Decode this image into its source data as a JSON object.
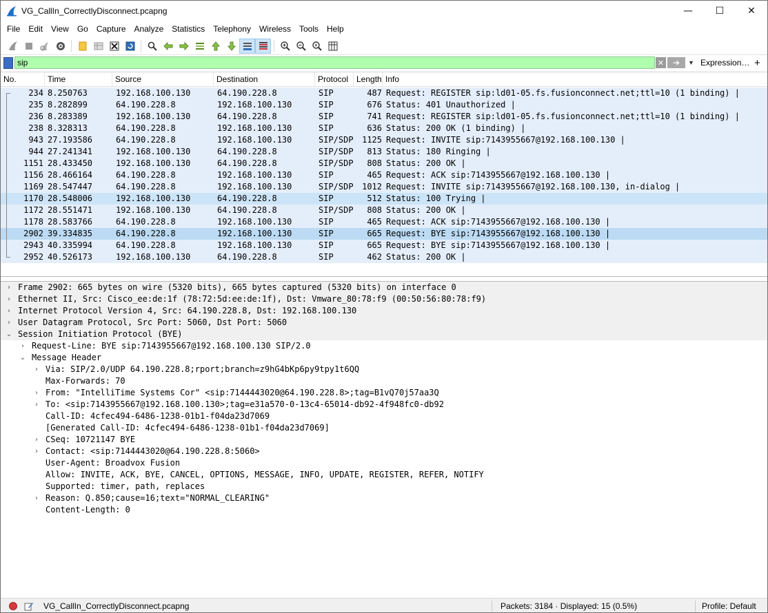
{
  "window": {
    "title": "VG_CallIn_CorrectlyDisconnect.pcapng",
    "minimize_glyph": "—",
    "maximize_glyph": "☐",
    "close_glyph": "✕"
  },
  "menu": [
    "File",
    "Edit",
    "View",
    "Go",
    "Capture",
    "Analyze",
    "Statistics",
    "Telephony",
    "Wireless",
    "Tools",
    "Help"
  ],
  "filter": {
    "value": "sip",
    "expression_label": "Expression…",
    "add_label": "+"
  },
  "packet_list": {
    "columns": [
      "No.",
      "Time",
      "Source",
      "Destination",
      "Protocol",
      "Length",
      "Info"
    ],
    "rows": [
      {
        "no": "234",
        "time": "8.250763",
        "src": "192.168.100.130",
        "dst": "64.190.228.8",
        "proto": "SIP",
        "len": "487",
        "info": "Request: REGISTER sip:ld01-05.fs.fusionconnect.net;ttl=10  (1 binding) |"
      },
      {
        "no": "235",
        "time": "8.282899",
        "src": "64.190.228.8",
        "dst": "192.168.100.130",
        "proto": "SIP",
        "len": "676",
        "info": "Status: 401 Unauthorized |"
      },
      {
        "no": "236",
        "time": "8.283389",
        "src": "192.168.100.130",
        "dst": "64.190.228.8",
        "proto": "SIP",
        "len": "741",
        "info": "Request: REGISTER sip:ld01-05.fs.fusionconnect.net;ttl=10  (1 binding) |"
      },
      {
        "no": "238",
        "time": "8.328313",
        "src": "64.190.228.8",
        "dst": "192.168.100.130",
        "proto": "SIP",
        "len": "636",
        "info": "Status: 200 OK  (1 binding) |"
      },
      {
        "no": "943",
        "time": "27.193586",
        "src": "64.190.228.8",
        "dst": "192.168.100.130",
        "proto": "SIP/SDP",
        "len": "1125",
        "info": "Request: INVITE sip:7143955667@192.168.100.130 |"
      },
      {
        "no": "944",
        "time": "27.241341",
        "src": "192.168.100.130",
        "dst": "64.190.228.8",
        "proto": "SIP/SDP",
        "len": "813",
        "info": "Status: 180 Ringing |"
      },
      {
        "no": "1151",
        "time": "28.433450",
        "src": "192.168.100.130",
        "dst": "64.190.228.8",
        "proto": "SIP/SDP",
        "len": "808",
        "info": "Status: 200 OK |"
      },
      {
        "no": "1156",
        "time": "28.466164",
        "src": "64.190.228.8",
        "dst": "192.168.100.130",
        "proto": "SIP",
        "len": "465",
        "info": "Request: ACK sip:7143955667@192.168.100.130 |"
      },
      {
        "no": "1169",
        "time": "28.547447",
        "src": "64.190.228.8",
        "dst": "192.168.100.130",
        "proto": "SIP/SDP",
        "len": "1012",
        "info": "Request: INVITE sip:7143955667@192.168.100.130, in-dialog |"
      },
      {
        "no": "1170",
        "time": "28.548006",
        "src": "192.168.100.130",
        "dst": "64.190.228.8",
        "proto": "SIP",
        "len": "512",
        "info": "Status: 100 Trying |"
      },
      {
        "no": "1172",
        "time": "28.551471",
        "src": "192.168.100.130",
        "dst": "64.190.228.8",
        "proto": "SIP/SDP",
        "len": "808",
        "info": "Status: 200 OK |"
      },
      {
        "no": "1178",
        "time": "28.583766",
        "src": "64.190.228.8",
        "dst": "192.168.100.130",
        "proto": "SIP",
        "len": "465",
        "info": "Request: ACK sip:7143955667@192.168.100.130 |"
      },
      {
        "no": "2902",
        "time": "39.334835",
        "src": "64.190.228.8",
        "dst": "192.168.100.130",
        "proto": "SIP",
        "len": "665",
        "info": "Request: BYE sip:7143955667@192.168.100.130 |"
      },
      {
        "no": "2943",
        "time": "40.335994",
        "src": "64.190.228.8",
        "dst": "192.168.100.130",
        "proto": "SIP",
        "len": "665",
        "info": "Request: BYE sip:7143955667@192.168.100.130 |"
      },
      {
        "no": "2952",
        "time": "40.526173",
        "src": "192.168.100.130",
        "dst": "64.190.228.8",
        "proto": "SIP",
        "len": "462",
        "info": "Status: 200 OK |"
      }
    ]
  },
  "details": [
    {
      "level": 0,
      "expander": "collapsed",
      "text": "Frame 2902: 665 bytes on wire (5320 bits), 665 bytes captured (5320 bits) on interface 0"
    },
    {
      "level": 0,
      "expander": "collapsed",
      "text": "Ethernet II, Src: Cisco_ee:de:1f (78:72:5d:ee:de:1f), Dst: Vmware_80:78:f9 (00:50:56:80:78:f9)"
    },
    {
      "level": 0,
      "expander": "collapsed",
      "text": "Internet Protocol Version 4, Src: 64.190.228.8, Dst: 192.168.100.130"
    },
    {
      "level": 0,
      "expander": "collapsed",
      "text": "User Datagram Protocol, Src Port: 5060, Dst Port: 5060"
    },
    {
      "level": 0,
      "expander": "expanded",
      "text": "Session Initiation Protocol (BYE)"
    },
    {
      "level": 1,
      "expander": "collapsed",
      "text": "Request-Line: BYE sip:7143955667@192.168.100.130 SIP/2.0"
    },
    {
      "level": 1,
      "expander": "expanded",
      "text": "Message Header"
    },
    {
      "level": 2,
      "expander": "collapsed",
      "text": "Via: SIP/2.0/UDP 64.190.228.8;rport;branch=z9hG4bKp6py9tpy1t6QQ"
    },
    {
      "level": 2,
      "expander": "none",
      "text": "Max-Forwards: 70"
    },
    {
      "level": 2,
      "expander": "collapsed",
      "text": "From: \"IntelliTime Systems Cor\" <sip:7144443020@64.190.228.8>;tag=B1vQ70j57aa3Q"
    },
    {
      "level": 2,
      "expander": "collapsed",
      "text": "To: <sip:7143955667@192.168.100.130>;tag=e31a570-0-13c4-65014-db92-4f948fc0-db92"
    },
    {
      "level": 2,
      "expander": "none",
      "text": "Call-ID: 4cfec494-6486-1238-01b1-f04da23d7069"
    },
    {
      "level": 2,
      "expander": "none",
      "text": "[Generated Call-ID: 4cfec494-6486-1238-01b1-f04da23d7069]"
    },
    {
      "level": 2,
      "expander": "collapsed",
      "text": "CSeq: 10721147 BYE"
    },
    {
      "level": 2,
      "expander": "collapsed",
      "text": "Contact: <sip:7144443020@64.190.228.8:5060>"
    },
    {
      "level": 2,
      "expander": "none",
      "text": "User-Agent: Broadvox Fusion"
    },
    {
      "level": 2,
      "expander": "none",
      "text": "Allow: INVITE, ACK, BYE, CANCEL, OPTIONS, MESSAGE, INFO, UPDATE, REGISTER, REFER, NOTIFY"
    },
    {
      "level": 2,
      "expander": "none",
      "text": "Supported: timer, path, replaces"
    },
    {
      "level": 2,
      "expander": "collapsed",
      "text": "Reason: Q.850;cause=16;text=\"NORMAL_CLEARING\""
    },
    {
      "level": 2,
      "expander": "none",
      "text": "Content-Length: 0"
    }
  ],
  "status": {
    "file": "VG_CallIn_CorrectlyDisconnect.pcapng",
    "packets": "Packets: 3184 · Displayed: 15 (0.5%)",
    "profile": "Profile: Default"
  },
  "colors": {
    "filter_valid": "#afffaf",
    "row_bg": "#e4eefb",
    "row_selected": "#cce4f7"
  }
}
